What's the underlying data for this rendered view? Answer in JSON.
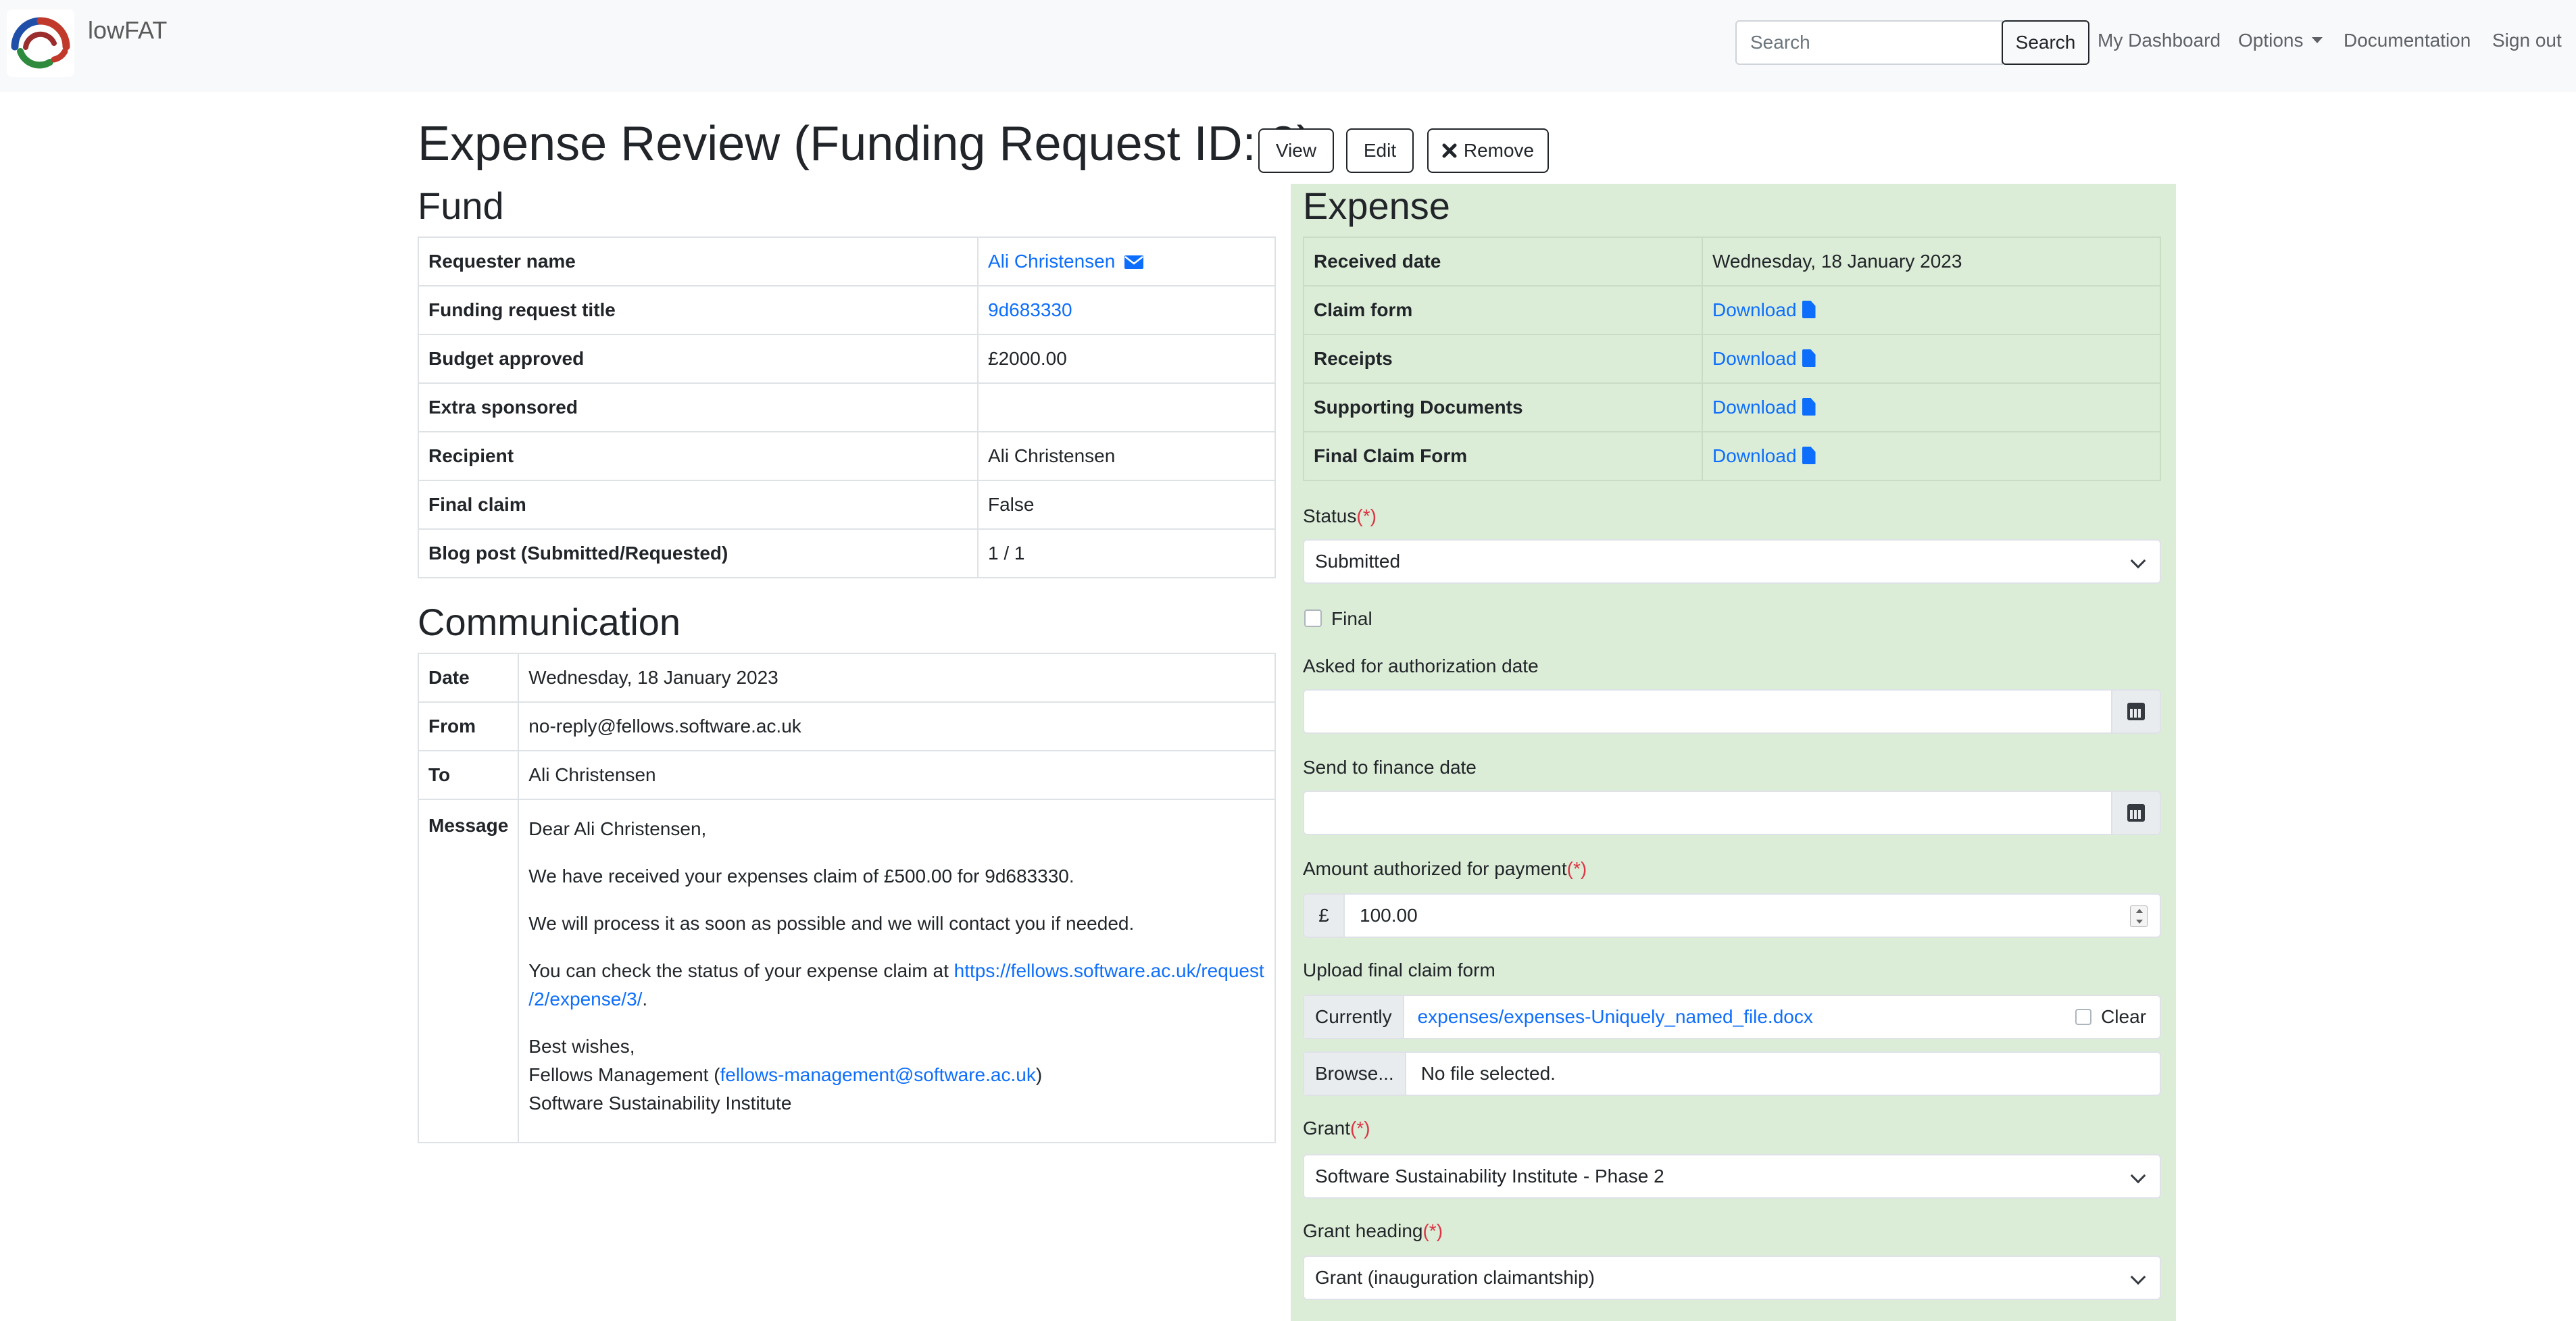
{
  "app": {
    "brand": "lowFAT"
  },
  "nav": {
    "search_placeholder": "Search",
    "search_button": "Search",
    "links": [
      "My Dashboard",
      "Options",
      "Documentation",
      "Sign out"
    ]
  },
  "header": {
    "title": "Expense Review (Funding Request ID: 2)",
    "buttons": {
      "view": "View",
      "edit": "Edit",
      "remove": "Remove"
    }
  },
  "fund": {
    "heading": "Fund",
    "rows": [
      {
        "label": "Requester name",
        "value": "Ali Christensen"
      },
      {
        "label": "Funding request title",
        "value": "9d683330"
      },
      {
        "label": "Budget approved",
        "value": "£2000.00"
      },
      {
        "label": "Extra sponsored",
        "value": ""
      },
      {
        "label": "Recipient",
        "value": "Ali Christensen"
      },
      {
        "label": "Final claim",
        "value": "False"
      },
      {
        "label": "Blog post (Submitted/Requested)",
        "value": "1 / 1"
      }
    ]
  },
  "communication": {
    "heading": "Communication",
    "date_label": "Date",
    "date": "Wednesday, 18 January 2023",
    "from_label": "From",
    "from": "no-reply@fellows.software.ac.uk",
    "to_label": "To",
    "to": "Ali Christensen",
    "message_label": "Message",
    "message": {
      "greeting": "Dear Ali Christensen,",
      "line1": "We have received your expenses claim of £500.00 for 9d683330.",
      "line2": "We will process it as soon as possible and we will contact you if needed.",
      "line3_prefix": "You can check the status of your expense claim at ",
      "line3_link_a": "https://fellows.software.ac.uk/request",
      "line3_link_b": "/2/expense/3/",
      "line3_suffix": ".",
      "signoff": "Best wishes,",
      "sig_prefix": "Fellows Management (",
      "sig_email": "fellows-management@software.ac.uk",
      "sig_suffix": ")",
      "org": "Software Sustainability Institute"
    }
  },
  "expense": {
    "heading": "Expense",
    "rows": [
      {
        "label": "Received date",
        "value": "Wednesday, 18 January 2023"
      },
      {
        "label": "Claim form",
        "value": "Download"
      },
      {
        "label": "Receipts",
        "value": "Download"
      },
      {
        "label": "Supporting Documents",
        "value": "Download"
      },
      {
        "label": "Final Claim Form",
        "value": "Download"
      }
    ]
  },
  "form": {
    "required_marker": "(*)",
    "status_label": "Status",
    "status_value": "Submitted",
    "final_label": "Final",
    "auth_date_label": "Asked for authorization date",
    "finance_date_label": "Send to finance date",
    "amount_label": "Amount authorized for payment",
    "currency": "£",
    "amount_value": "100.00",
    "upload_label": "Upload final claim form",
    "currently_label": "Currently",
    "current_file": "expenses/expenses-Uniquely_named_file.docx",
    "clear_label": "Clear",
    "browse_label": "Browse...",
    "no_file": "No file selected.",
    "grant_label": "Grant",
    "grant_value": "Software Sustainability Institute - Phase 2",
    "grant_heading_label": "Grant heading",
    "grant_heading_value": "Grant (inauguration claimantship)"
  }
}
